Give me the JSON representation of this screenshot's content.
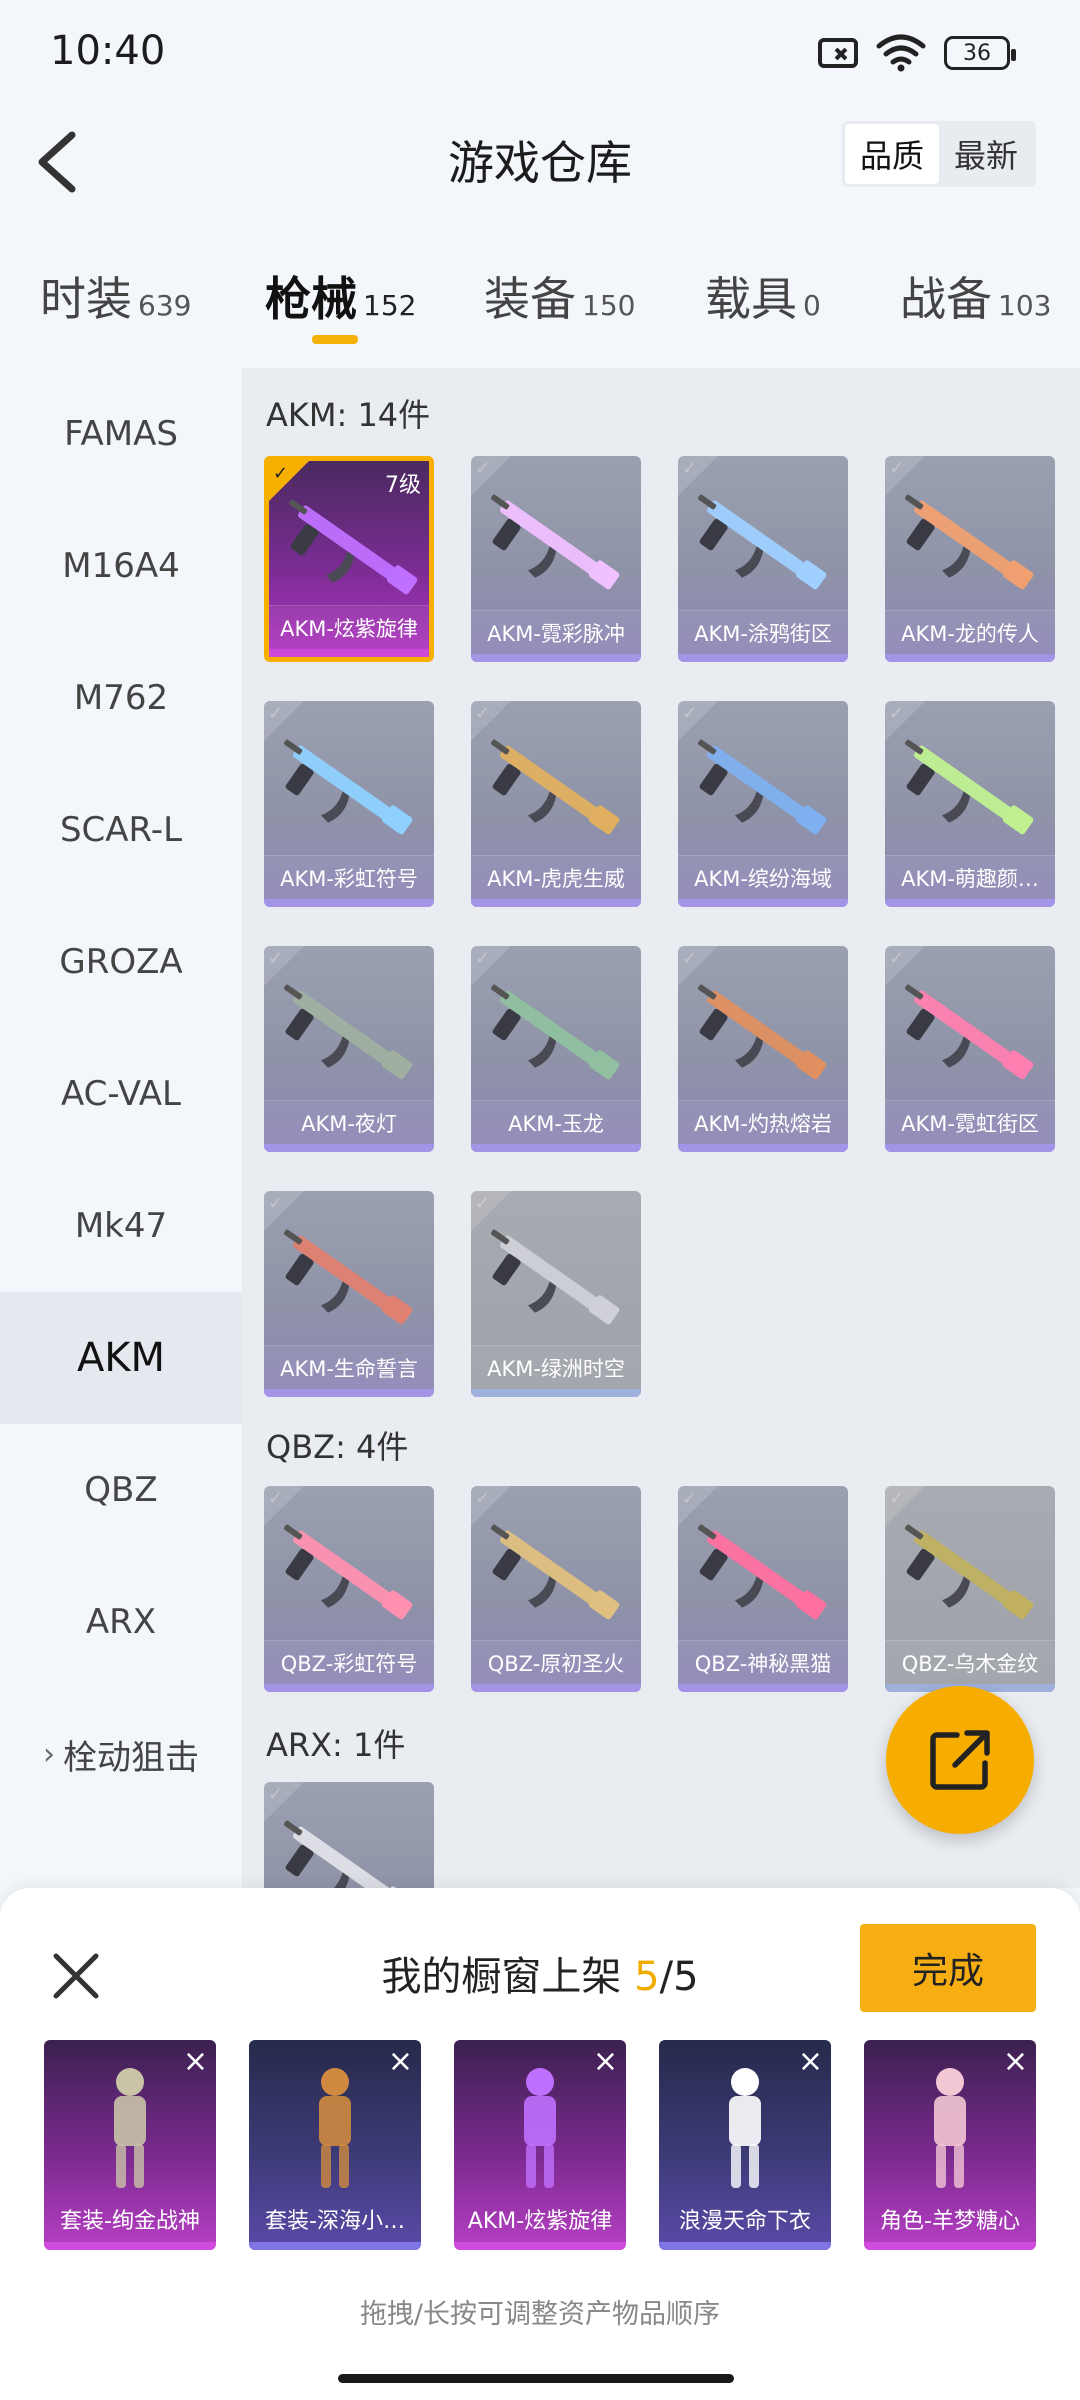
{
  "status_bar": {
    "time": "10:40",
    "battery": "36"
  },
  "header": {
    "title": "游戏仓库",
    "sort": [
      "品质",
      "最新"
    ],
    "sort_active": 0
  },
  "tabs": [
    {
      "label": "时装",
      "count": "639"
    },
    {
      "label": "枪械",
      "count": "152"
    },
    {
      "label": "装备",
      "count": "150"
    },
    {
      "label": "载具",
      "count": "0"
    },
    {
      "label": "战备",
      "count": "103"
    }
  ],
  "active_tab": 1,
  "sidebar": {
    "items": [
      "FAMAS",
      "M16A4",
      "M762",
      "SCAR-L",
      "GROZA",
      "AC-VAL",
      "Mk47",
      "AKM",
      "QBZ",
      "ARX",
      "栓动狙击"
    ],
    "active": "AKM"
  },
  "sections": [
    {
      "title": "AKM: 14件",
      "items": [
        {
          "name": "AKM-炫紫旋律",
          "level": "7级",
          "selected": true
        },
        {
          "name": "AKM-霓彩脉冲"
        },
        {
          "name": "AKM-涂鸦街区"
        },
        {
          "name": "AKM-龙的传人"
        },
        {
          "name": "AKM-彩虹符号"
        },
        {
          "name": "AKM-虎虎生威"
        },
        {
          "name": "AKM-缤纷海域"
        },
        {
          "name": "AKM-萌趣颜…"
        },
        {
          "name": "AKM-夜灯"
        },
        {
          "name": "AKM-玉龙"
        },
        {
          "name": "AKM-灼热熔岩"
        },
        {
          "name": "AKM-霓虹街区"
        },
        {
          "name": "AKM-生命誓言"
        },
        {
          "name": "AKM-绿洲时空",
          "gray": true
        }
      ]
    },
    {
      "title": "QBZ: 4件",
      "items": [
        {
          "name": "QBZ-彩虹符号"
        },
        {
          "name": "QBZ-原初圣火"
        },
        {
          "name": "QBZ-神秘黑猫"
        },
        {
          "name": "QBZ-乌木金纹",
          "gray": true
        }
      ]
    },
    {
      "title": "ARX: 1件",
      "items": [
        {
          "name": ""
        }
      ]
    }
  ],
  "gun_colors": [
    "#c070ff",
    "#f0c0ff",
    "#9fd0ff",
    "#f0a070",
    "#8fd0ff",
    "#e0b060",
    "#7fb0f0",
    "#c0f090",
    "#9fb0a0",
    "#90c0a0",
    "#e09060",
    "#ff80b0",
    "#e08070",
    "#cfd0d8",
    "#ff90b0",
    "#e0c080",
    "#ff70a0",
    "#c0b060",
    "#e0e0e8"
  ],
  "showcase": {
    "title_prefix": "我的橱窗上架 ",
    "count": "5",
    "total": "/5",
    "done_label": "完成",
    "hint": "拖拽/长按可调整资产物品顺序",
    "items": [
      {
        "name": "套装-绚金战神",
        "variant": "purple"
      },
      {
        "name": "套装-深海小…",
        "variant": "blue"
      },
      {
        "name": "AKM-炫紫旋律",
        "variant": "purple"
      },
      {
        "name": "浪漫天命下衣",
        "variant": "blue"
      },
      {
        "name": "角色-羊梦糖心",
        "variant": "purple"
      }
    ]
  },
  "colors": {
    "accent": "#f7ae12",
    "tab_underline": "#f5b30a"
  }
}
